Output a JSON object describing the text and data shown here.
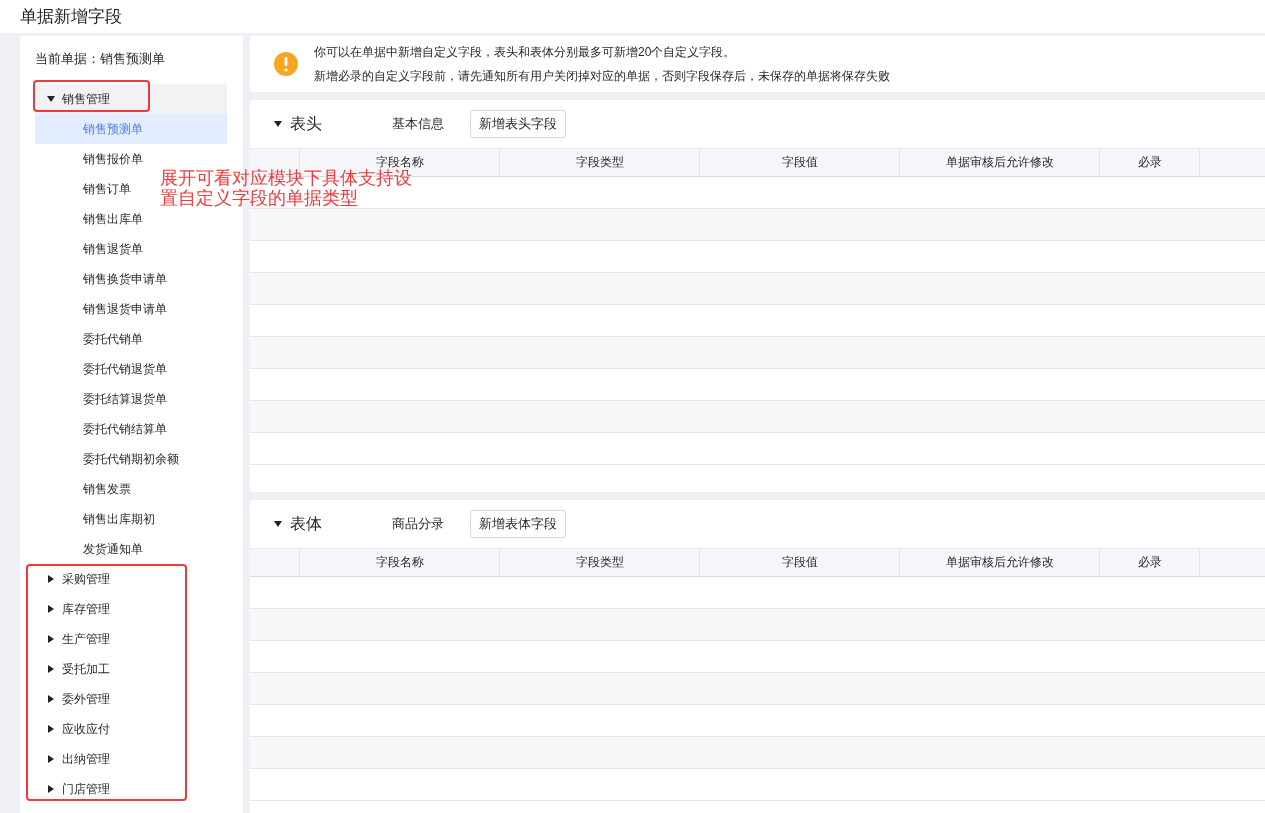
{
  "window": {
    "title": "单据新增字段"
  },
  "sidebar": {
    "current_label": "当前单据：销售预测单",
    "tree": [
      {
        "label": "销售管理",
        "expanded": true,
        "children": [
          {
            "label": "销售预测单",
            "selected": true
          },
          {
            "label": "销售报价单",
            "selected": false
          },
          {
            "label": "销售订单",
            "selected": false
          },
          {
            "label": "销售出库单",
            "selected": false
          },
          {
            "label": "销售退货单",
            "selected": false
          },
          {
            "label": "销售换货申请单",
            "selected": false
          },
          {
            "label": "销售退货申请单",
            "selected": false
          },
          {
            "label": "委托代销单",
            "selected": false
          },
          {
            "label": "委托代销退货单",
            "selected": false
          },
          {
            "label": "委托结算退货单",
            "selected": false
          },
          {
            "label": "委托代销结算单",
            "selected": false
          },
          {
            "label": "委托代销期初余额",
            "selected": false
          },
          {
            "label": "销售发票",
            "selected": false
          },
          {
            "label": "销售出库期初",
            "selected": false
          },
          {
            "label": "发货通知单",
            "selected": false
          }
        ]
      },
      {
        "label": "采购管理",
        "expanded": false
      },
      {
        "label": "库存管理",
        "expanded": false
      },
      {
        "label": "生产管理",
        "expanded": false
      },
      {
        "label": "受托加工",
        "expanded": false
      },
      {
        "label": "委外管理",
        "expanded": false
      },
      {
        "label": "应收应付",
        "expanded": false
      },
      {
        "label": "出纳管理",
        "expanded": false
      },
      {
        "label": "门店管理",
        "expanded": false
      }
    ]
  },
  "annotation": {
    "note": "展开可看对应模块下具体支持设置自定义字段的单据类型"
  },
  "notice": {
    "lines": [
      "你可以在单据中新增自定义字段，表头和表体分别最多可新增20个自定义字段。",
      "新增必录的自定义字段前，请先通知所有用户关闭掉对应的单据，否则字段保存后，未保存的单据将保存失败"
    ]
  },
  "sections": [
    {
      "title": "表头",
      "expanded": true,
      "subtitle": "基本信息",
      "button": "新增表头字段",
      "columns": [
        "字段名称",
        "字段类型",
        "字段值",
        "单据审核后允许修改",
        "必录"
      ]
    },
    {
      "title": "表体",
      "expanded": true,
      "subtitle": "商品分录",
      "button": "新增表体字段",
      "columns": [
        "字段名称",
        "字段类型",
        "字段值",
        "单据审核后允许修改",
        "必录"
      ]
    }
  ]
}
